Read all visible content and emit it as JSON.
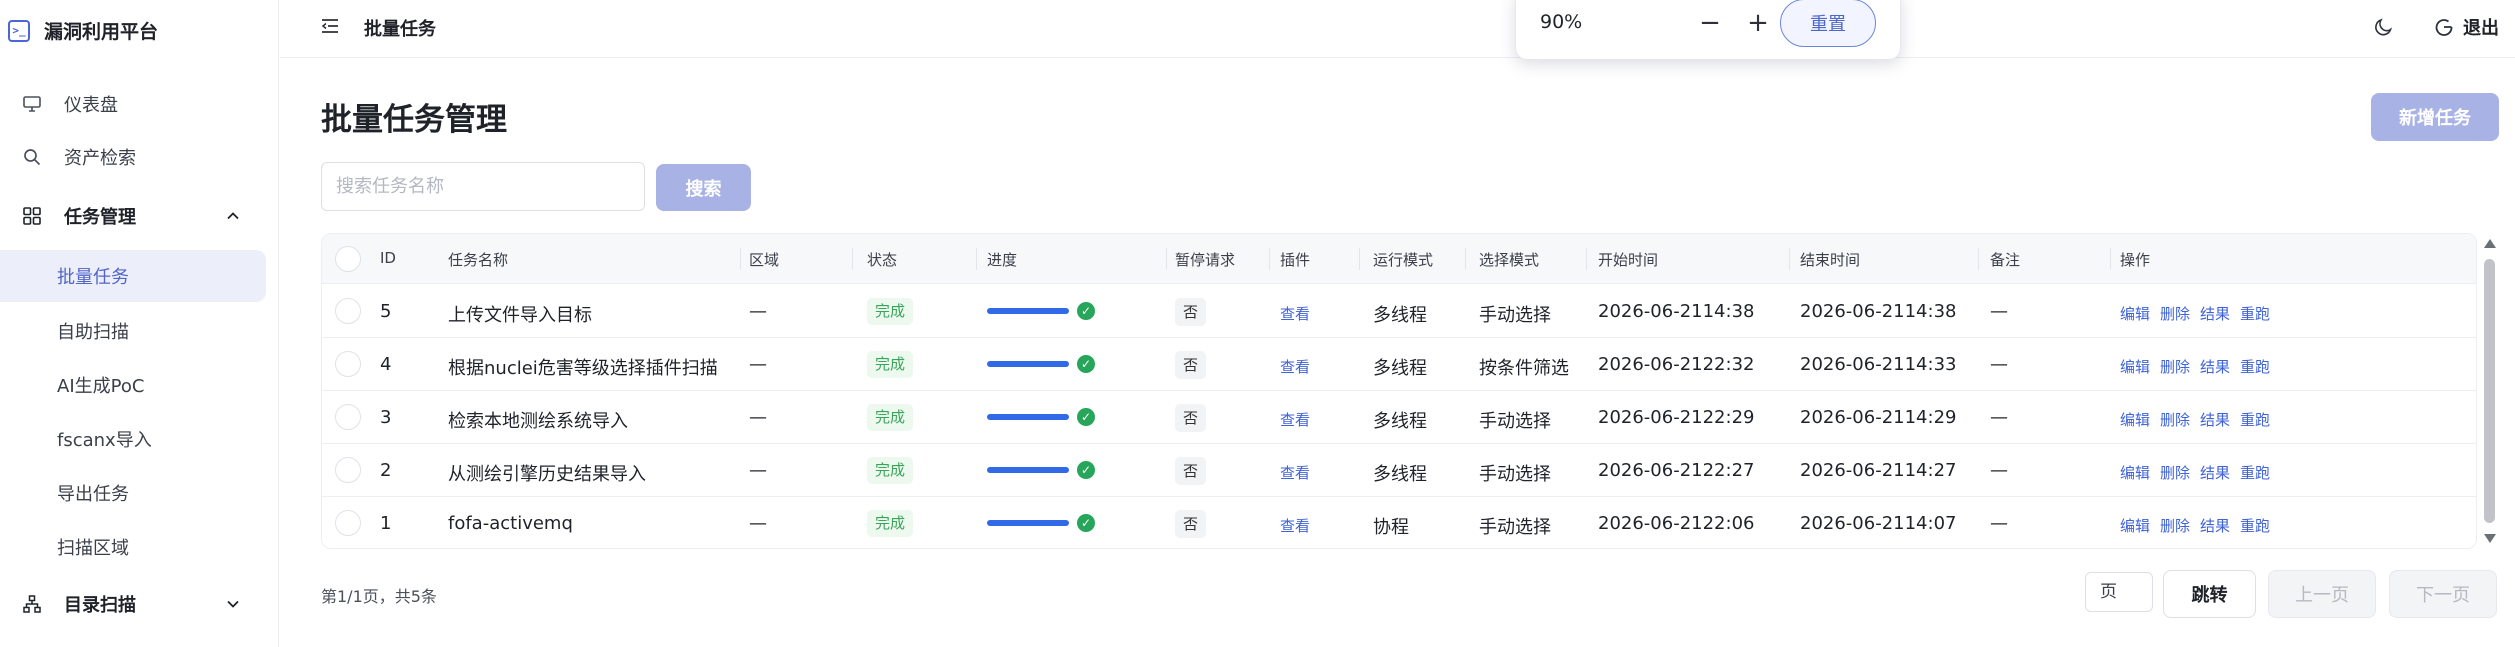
{
  "app": {
    "name": "漏洞利用平台",
    "logo_icon": "terminal-icon"
  },
  "sidebar": {
    "items": [
      {
        "label": "仪表盘",
        "icon": "monitor-icon"
      },
      {
        "label": "资产检索",
        "icon": "search-icon"
      }
    ],
    "task_group": {
      "label": "任务管理",
      "icon": "grid-icon",
      "expanded": true,
      "children": [
        {
          "label": "批量任务",
          "active": true
        },
        {
          "label": "自助扫描"
        },
        {
          "label": "AI生成PoC"
        },
        {
          "label": "fscanx导入"
        },
        {
          "label": "导出任务"
        },
        {
          "label": "扫描区域"
        }
      ]
    },
    "dir_group": {
      "label": "目录扫描",
      "icon": "sitemap-icon",
      "expanded": false
    }
  },
  "header": {
    "breadcrumb": "批量任务",
    "logout_label": "退出"
  },
  "zoom": {
    "value": "90%",
    "minus": "−",
    "plus": "+",
    "reset_label": "重置"
  },
  "main": {
    "title": "批量任务管理",
    "add_label": "新增任务",
    "search_placeholder": "搜索任务名称",
    "search_label": "搜索"
  },
  "table": {
    "columns": [
      "ID",
      "任务名称",
      "区域",
      "状态",
      "进度",
      "暂停请求",
      "插件",
      "运行模式",
      "选择模式",
      "开始时间",
      "结束时间",
      "备注",
      "操作"
    ],
    "action_labels": [
      "编辑",
      "删除",
      "结果",
      "重跑"
    ],
    "rows": [
      {
        "id": "5",
        "name": "上传文件导入目标",
        "region": "—",
        "status": "完成",
        "progress": 1.0,
        "pause": "否",
        "plugin": "查看",
        "run_mode": "多线程",
        "select_mode": "手动选择",
        "start": "2026-06-2114:38",
        "end": "2026-06-2114:38",
        "note": "—"
      },
      {
        "id": "4",
        "name": "根据nuclei危害等级选择插件扫描",
        "region": "—",
        "status": "完成",
        "progress": 1.0,
        "pause": "否",
        "plugin": "查看",
        "run_mode": "多线程",
        "select_mode": "按条件筛选",
        "start": "2026-06-2122:32",
        "end": "2026-06-2114:33",
        "note": "—"
      },
      {
        "id": "3",
        "name": "检索本地测绘系统导入",
        "region": "—",
        "status": "完成",
        "progress": 1.0,
        "pause": "否",
        "plugin": "查看",
        "run_mode": "多线程",
        "select_mode": "手动选择",
        "start": "2026-06-2122:29",
        "end": "2026-06-2114:29",
        "note": "—"
      },
      {
        "id": "2",
        "name": "从测绘引擎历史结果导入",
        "region": "—",
        "status": "完成",
        "progress": 1.0,
        "pause": "否",
        "plugin": "查看",
        "run_mode": "多线程",
        "select_mode": "手动选择",
        "start": "2026-06-2122:27",
        "end": "2026-06-2114:27",
        "note": "—"
      },
      {
        "id": "1",
        "name": "fofa-activemq",
        "region": "—",
        "status": "完成",
        "progress": 1.0,
        "pause": "否",
        "plugin": "查看",
        "run_mode": "协程",
        "select_mode": "手动选择",
        "start": "2026-06-2122:06",
        "end": "2026-06-2114:07",
        "note": "—"
      }
    ]
  },
  "pagination": {
    "info": "第1/1页，共5条",
    "page_placeholder": "页",
    "jump_label": "跳转",
    "prev_label": "上一页",
    "next_label": "下一页"
  },
  "colors": {
    "accent": "#5165c8",
    "primary_disabled": "#a8b2e4",
    "link": "#3f63d9",
    "success": "#27a65b",
    "progress": "#3269e6"
  }
}
